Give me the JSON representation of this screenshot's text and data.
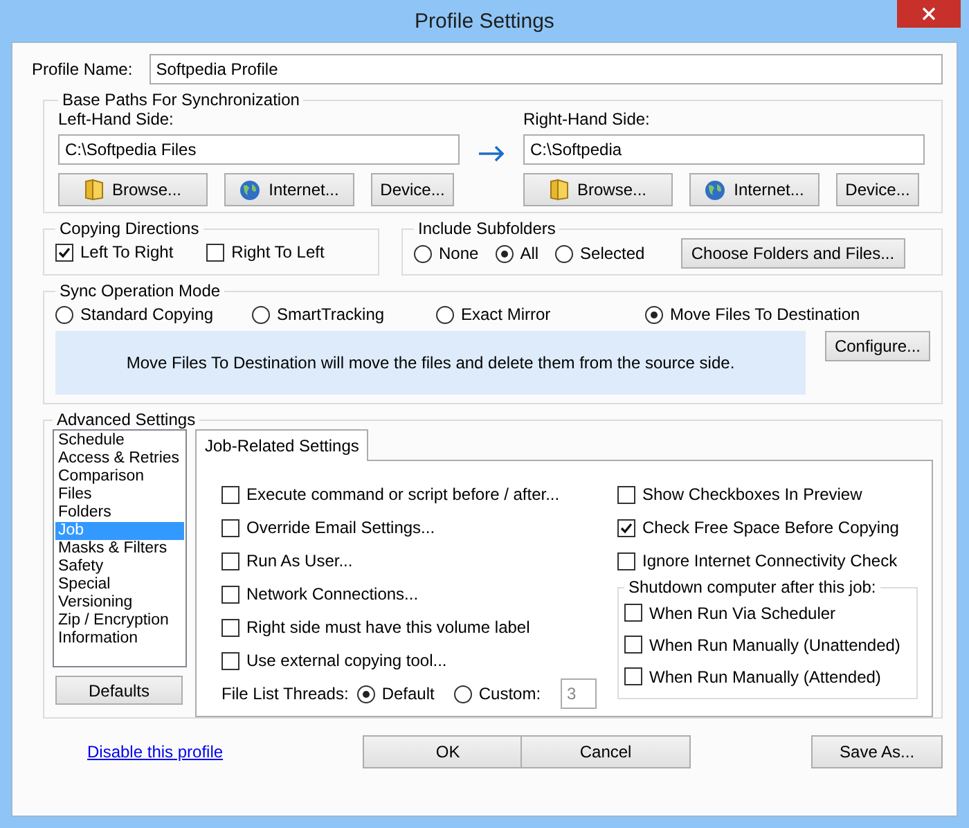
{
  "window": {
    "title": "Profile Settings"
  },
  "profile_name": {
    "label": "Profile Name:",
    "value": "Softpedia Profile"
  },
  "base_paths": {
    "title": "Base Paths For Synchronization",
    "left": {
      "label": "Left-Hand Side:",
      "value": "C:\\Softpedia Files",
      "buttons": [
        "Browse...",
        "Internet...",
        "Device..."
      ]
    },
    "right": {
      "label": "Right-Hand Side:",
      "value": "C:\\Softpedia",
      "buttons": [
        "Browse...",
        "Internet...",
        "Device..."
      ]
    }
  },
  "copying_directions": {
    "title": "Copying Directions",
    "options": [
      {
        "label": "Left To Right",
        "checked": true
      },
      {
        "label": "Right To Left",
        "checked": false
      }
    ]
  },
  "include_subfolders": {
    "title": "Include Subfolders",
    "options": [
      {
        "label": "None",
        "selected": false
      },
      {
        "label": "All",
        "selected": true
      },
      {
        "label": "Selected",
        "selected": false
      }
    ],
    "button": "Choose Folders and Files..."
  },
  "sync_mode": {
    "title": "Sync Operation Mode",
    "options": [
      {
        "label": "Standard Copying",
        "selected": false
      },
      {
        "label": "SmartTracking",
        "selected": false
      },
      {
        "label": "Exact Mirror",
        "selected": false
      },
      {
        "label": "Move Files To Destination",
        "selected": true
      }
    ],
    "description": "Move Files To Destination will move the files and delete them from the source side.",
    "button": "Configure..."
  },
  "advanced": {
    "title": "Advanced Settings",
    "categories": [
      {
        "label": "Schedule",
        "selected": false
      },
      {
        "label": "Access & Retries",
        "selected": false
      },
      {
        "label": "Comparison",
        "selected": false
      },
      {
        "label": "Files",
        "selected": false
      },
      {
        "label": "Folders",
        "selected": false
      },
      {
        "label": "Job",
        "selected": true
      },
      {
        "label": "Masks & Filters",
        "selected": false
      },
      {
        "label": "Safety",
        "selected": false
      },
      {
        "label": "Special",
        "selected": false
      },
      {
        "label": "Versioning",
        "selected": false
      },
      {
        "label": "Zip / Encryption",
        "selected": false
      },
      {
        "label": "Information",
        "selected": false
      }
    ],
    "defaults_button": "Defaults",
    "tabs": [
      {
        "label": "Job-Related Settings",
        "selected": true
      }
    ],
    "left_options": [
      {
        "label": "Execute command or script before / after...",
        "checked": false
      },
      {
        "label": "Override Email Settings...",
        "checked": false
      },
      {
        "label": "Run As User...",
        "checked": false
      },
      {
        "label": "Network Connections...",
        "checked": false
      },
      {
        "label": "Right side must have this volume label",
        "checked": false
      },
      {
        "label": "Use external copying tool...",
        "checked": false
      }
    ],
    "threads": {
      "label": "File List Threads:",
      "options": [
        {
          "label": "Default",
          "selected": true
        },
        {
          "label": "Custom:",
          "selected": false
        }
      ],
      "custom_value": "3"
    },
    "right_options": [
      {
        "label": "Show Checkboxes In Preview",
        "checked": false
      },
      {
        "label": "Check Free Space Before Copying",
        "checked": true
      },
      {
        "label": "Ignore Internet Connectivity Check",
        "checked": false
      }
    ],
    "shutdown": {
      "title": "Shutdown computer after this job:",
      "options": [
        {
          "label": "When Run Via Scheduler",
          "checked": false
        },
        {
          "label": "When Run Manually (Unattended)",
          "checked": false
        },
        {
          "label": "When Run Manually (Attended)",
          "checked": false
        }
      ]
    }
  },
  "footer": {
    "link": "Disable this profile",
    "buttons": [
      "OK",
      "Cancel",
      "Save As..."
    ]
  }
}
